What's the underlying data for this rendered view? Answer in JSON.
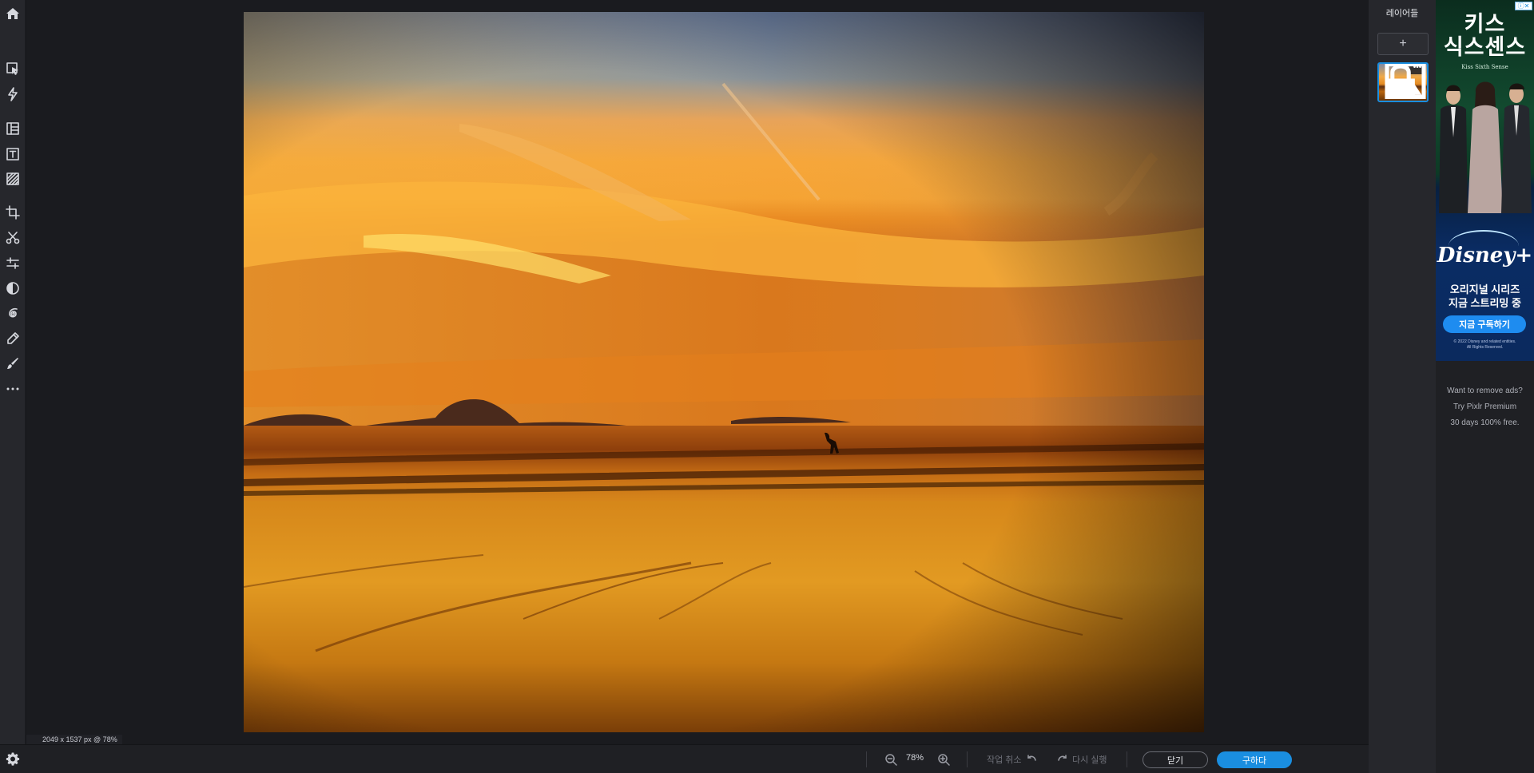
{
  "toolbar": {
    "tools": [
      {
        "name": "home-icon"
      },
      {
        "name": "arrange-select-icon"
      },
      {
        "name": "quick-fix-icon"
      },
      {
        "name": "layout-template-icon"
      },
      {
        "name": "text-icon"
      },
      {
        "name": "texture-icon"
      },
      {
        "name": "crop-icon"
      },
      {
        "name": "cutout-icon"
      },
      {
        "name": "adjust-icon"
      },
      {
        "name": "filter-icon"
      },
      {
        "name": "liquify-icon"
      },
      {
        "name": "retouch-icon"
      },
      {
        "name": "draw-icon"
      },
      {
        "name": "more-icon"
      }
    ]
  },
  "canvas": {
    "size_info": "2049 x 1537 px @ 78%"
  },
  "bottom_bar": {
    "zoom": "78%",
    "undo_label": "작업 취소",
    "redo_label": "다시 실행",
    "close_label": "닫기",
    "save_label": "구하다"
  },
  "layers_panel": {
    "title": "레이어들",
    "add_symbol": "+",
    "more_symbol": "•••"
  },
  "ad": {
    "close_badge": "ⓘ✕",
    "show_title_line1": "키스",
    "show_title_line2": "식스센스",
    "show_title_en": "Kiss Sixth Sense",
    "brand": "Disney+",
    "subtitle_line1": "오리지널 시리즈",
    "subtitle_line2": "지금 스트리밍 중",
    "cta": "지금 구독하기",
    "legal_line1": "© 2022 Disney and related entities.",
    "legal_line2": "All Rights Reserved."
  },
  "promo": {
    "line1": "Want to remove ads?",
    "line2": "Try Pixlr Premium",
    "line3": "30 days 100% free."
  },
  "colors": {
    "accent": "#1a8ee0",
    "background": "#1a1b1f",
    "panel": "#26272c"
  }
}
